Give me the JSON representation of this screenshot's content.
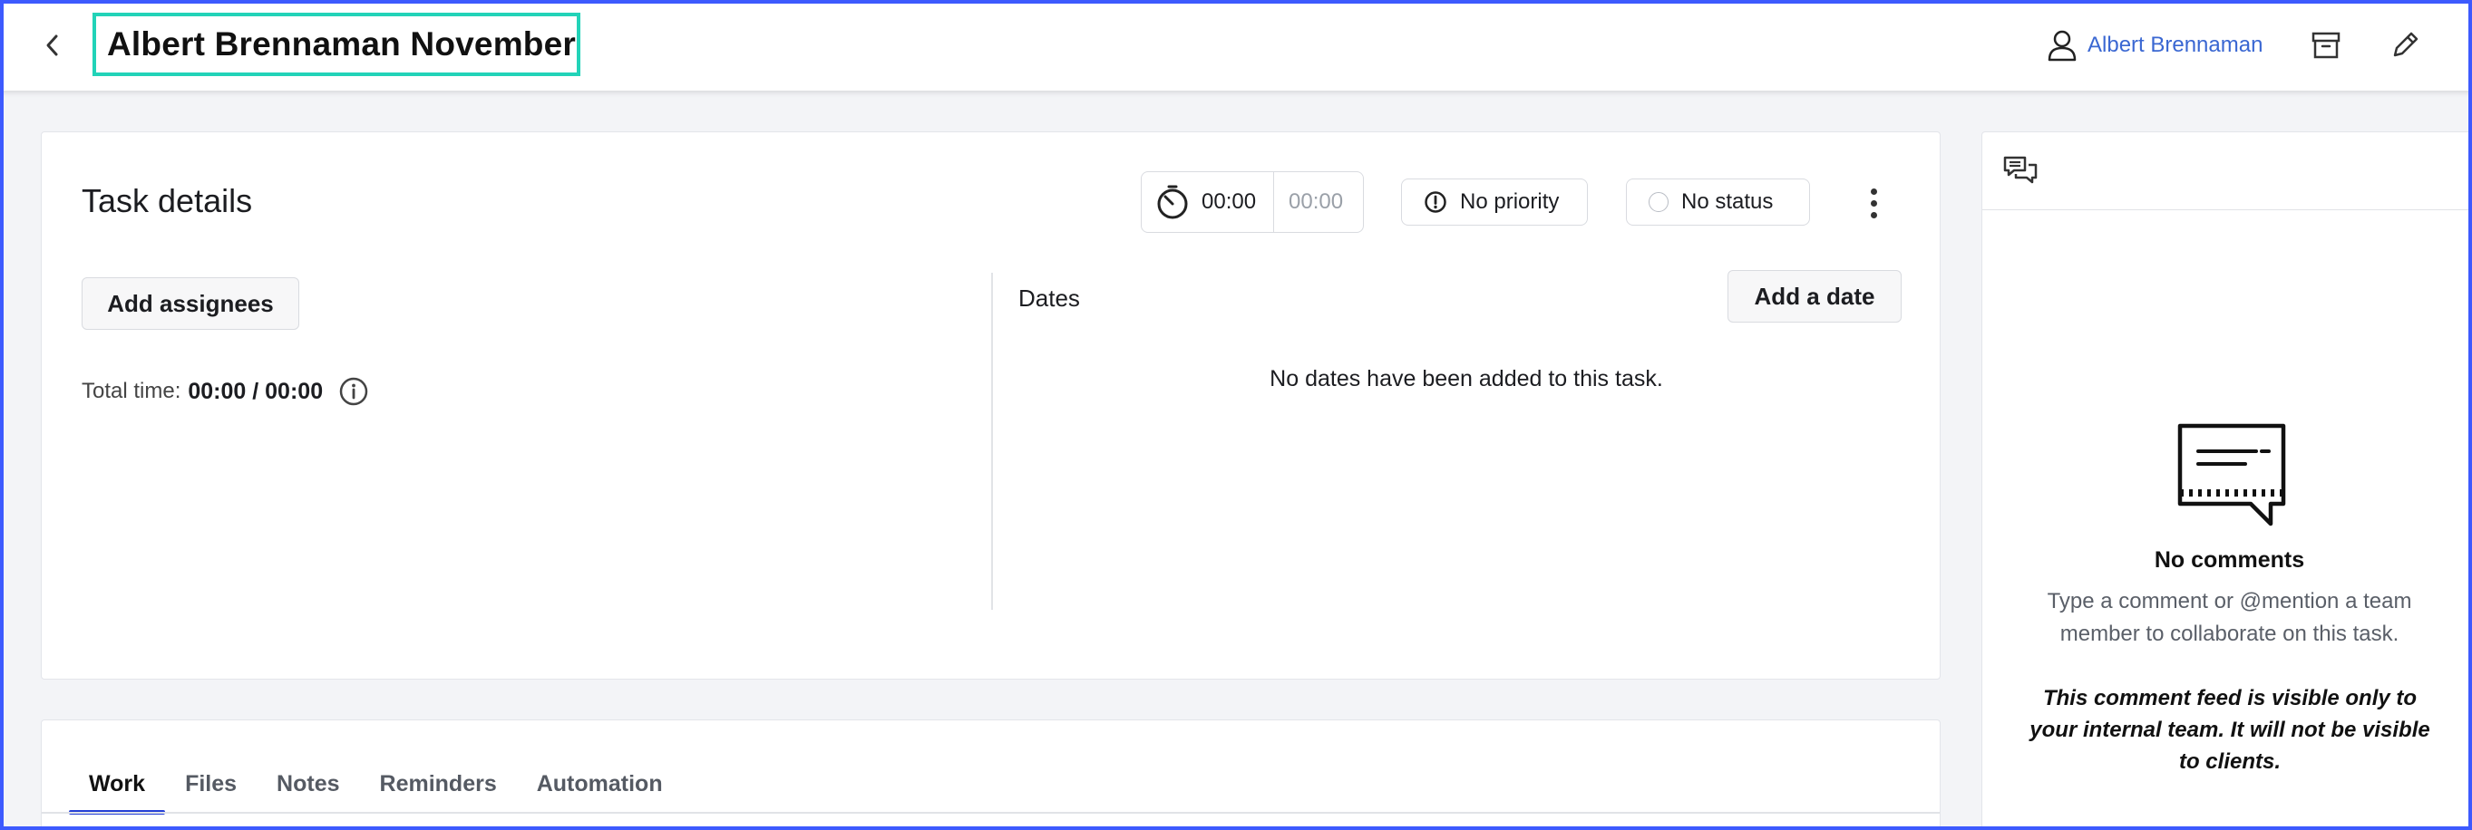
{
  "header": {
    "title": "Albert Brennaman November",
    "user_name": "Albert Brennaman",
    "icons": [
      "back-chevron-icon",
      "user-icon",
      "archive-icon",
      "pencil-icon"
    ]
  },
  "task": {
    "heading": "Task details",
    "timer": {
      "tracked": "00:00",
      "estimate": "00:00"
    },
    "priority_label": "No priority",
    "status_label": "No status",
    "add_assignees_label": "Add assignees",
    "total_time_label": "Total time:",
    "total_time_value": "00:00 / 00:00",
    "dates_label": "Dates",
    "add_date_label": "Add a date",
    "no_dates_text": "No dates have been added to this task."
  },
  "tabs": [
    {
      "label": "Work",
      "active": true
    },
    {
      "label": "Files",
      "active": false
    },
    {
      "label": "Notes",
      "active": false
    },
    {
      "label": "Reminders",
      "active": false
    },
    {
      "label": "Automation",
      "active": false
    }
  ],
  "comments": {
    "title": "No comments",
    "hint": "Type a comment or @mention a team member to collaborate on this task.",
    "visibility_note": "This comment feed is visible only to your internal team. It will not be visible to clients."
  },
  "colors": {
    "accent": "#2540d6",
    "highlight": "#22d3b8",
    "link": "#3a67d2",
    "frame": "#3d5afe"
  }
}
